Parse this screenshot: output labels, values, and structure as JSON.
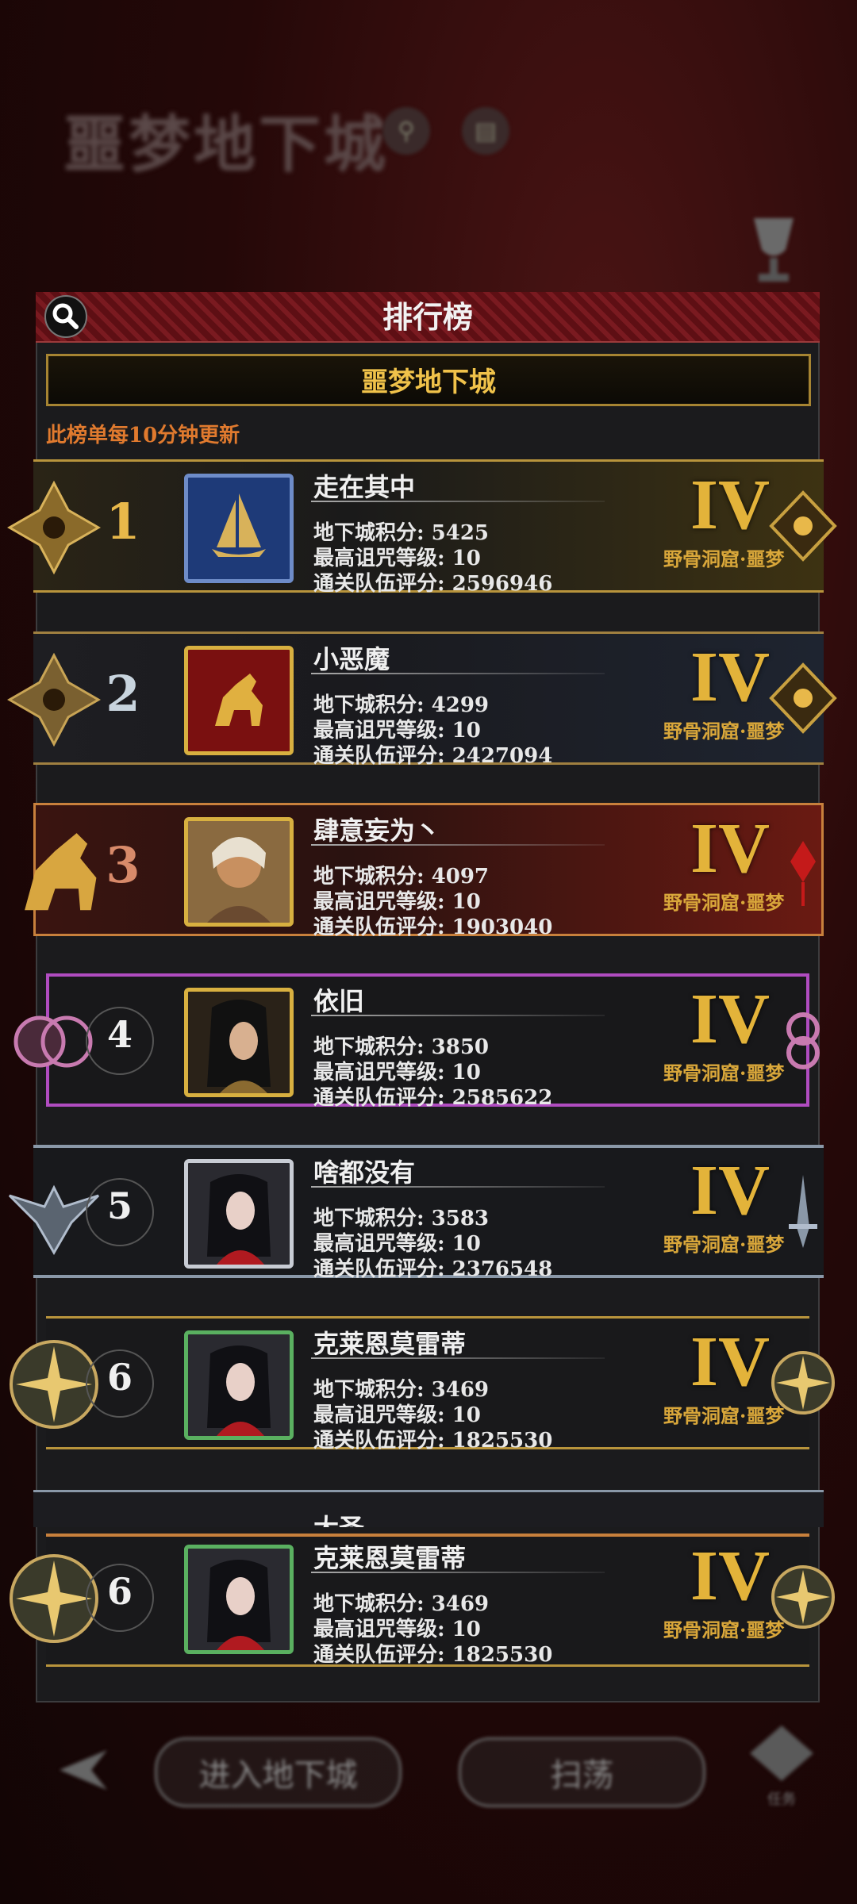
{
  "background": {
    "title": "噩梦地下城",
    "bottom_buttons": [
      "进入地下城",
      "扫荡"
    ],
    "bottom_right_label": "任务"
  },
  "panel": {
    "title": "排行榜",
    "sub_tab": "噩梦地下城",
    "notice": "此榜单每10分钟更新"
  },
  "labels": {
    "score": "地下城积分: ",
    "curse": "最高诅咒等级: ",
    "rating": "通关队伍评分: "
  },
  "rows": [
    {
      "rank": "1",
      "name": "走在其中",
      "score": "5425",
      "curse": "10",
      "rating": "2596946",
      "tier": "IV",
      "tier_sub": "野骨洞窟·噩梦"
    },
    {
      "rank": "2",
      "name": "小恶魔",
      "score": "4299",
      "curse": "10",
      "rating": "2427094",
      "tier": "IV",
      "tier_sub": "野骨洞窟·噩梦"
    },
    {
      "rank": "3",
      "name": "肆意妄为丶",
      "score": "4097",
      "curse": "10",
      "rating": "1903040",
      "tier": "IV",
      "tier_sub": "野骨洞窟·噩梦"
    },
    {
      "rank": "4",
      "name": "依旧",
      "score": "3850",
      "curse": "10",
      "rating": "2585622",
      "tier": "IV",
      "tier_sub": "野骨洞窟·噩梦"
    },
    {
      "rank": "5",
      "name": "啥都没有",
      "score": "3583",
      "curse": "10",
      "rating": "2376548",
      "tier": "IV",
      "tier_sub": "野骨洞窟·噩梦"
    },
    {
      "rank": "6",
      "name": "克莱恩莫雷蒂",
      "score": "3469",
      "curse": "10",
      "rating": "1825530",
      "tier": "IV",
      "tier_sub": "野骨洞窟·噩梦"
    },
    {
      "rank": "6",
      "name": "克莱恩莫雷蒂",
      "score": "3469",
      "curse": "10",
      "rating": "1825530",
      "tier": "IV",
      "tier_sub": "野骨洞窟·噩梦"
    }
  ],
  "partial_row": {
    "name": "大圣"
  },
  "colors": {
    "gold": "#e3b33a",
    "notice": "#e07a2e",
    "header_red": "#6e141a",
    "rank4_purple": "#b04cc0",
    "rank3_red": "#7a1a14"
  }
}
